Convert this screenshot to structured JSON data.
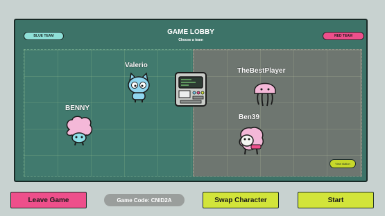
{
  "lobby": {
    "title": "GAME LOBBY",
    "subtitle": "Choose a team",
    "blue_team_label": "BLUE TEAM",
    "red_team_label": "RED TEAM",
    "view_button_label": "View station"
  },
  "players": [
    {
      "name": "Valerio",
      "team": "blue",
      "character": "blue-cat"
    },
    {
      "name": "BENNY",
      "team": "blue",
      "character": "pink-brain"
    },
    {
      "name": "TheBestPlayer",
      "team": "red",
      "character": "pink-jellyfish"
    },
    {
      "name": "Ben39",
      "team": "red",
      "character": "pink-dog"
    }
  ],
  "footer": {
    "leave_label": "Leave Game",
    "code_label": "Game Code: CNID2A",
    "swap_label": "Swap Character",
    "start_label": "Start"
  },
  "colors": {
    "pink": "#ee4f8b",
    "lime": "#d2e43a",
    "teal_panel": "#3d7368",
    "blue_team": "#8fe0d8"
  }
}
